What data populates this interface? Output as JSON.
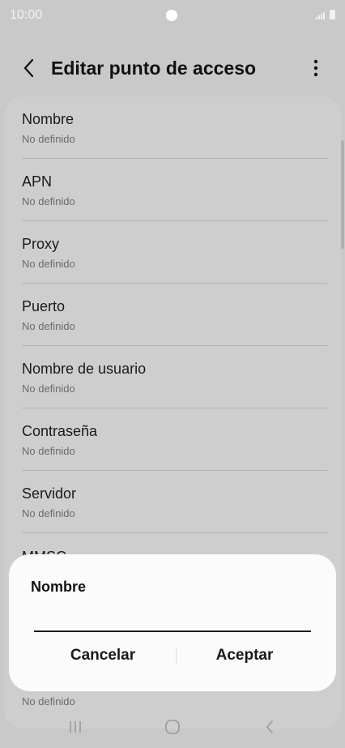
{
  "status_bar": {
    "time": "10:00"
  },
  "header": {
    "title": "Editar punto de acceso",
    "back_icon": "chevron-left-icon",
    "more_icon": "more-vertical-icon"
  },
  "list": {
    "items": [
      {
        "title": "Nombre",
        "value": "No definido"
      },
      {
        "title": "APN",
        "value": "No definido"
      },
      {
        "title": "Proxy",
        "value": "No definido"
      },
      {
        "title": "Puerto",
        "value": "No definido"
      },
      {
        "title": "Nombre de usuario",
        "value": "No definido"
      },
      {
        "title": "Contraseña",
        "value": "No definido"
      },
      {
        "title": "Servidor",
        "value": "No definido"
      }
    ],
    "partial_item_title": "MMSC",
    "bottom_item_value": "No definido"
  },
  "dialog": {
    "title": "Nombre",
    "input_value": "",
    "cancel_label": "Cancelar",
    "accept_label": "Aceptar"
  },
  "nav_bar": {
    "recents_icon": "recents-icon",
    "home_icon": "home-icon",
    "back_icon": "back-icon"
  },
  "colors": {
    "background": "#c9c9c9",
    "dialog": "#fbfbfb",
    "text": "#1a1a1a",
    "secondary_text": "#6b6b6b"
  }
}
